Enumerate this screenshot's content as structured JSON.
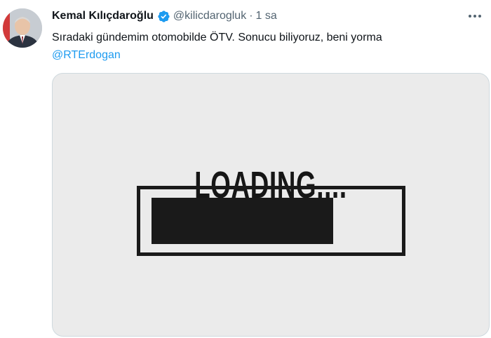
{
  "tweet": {
    "author": {
      "display_name": "Kemal Kılıçdaroğlu",
      "handle": "@kilicdarogluk",
      "verified": true,
      "avatar": "profile-photo"
    },
    "separator": "·",
    "time": "1 sa",
    "text": "Sıradaki gündemim otomobilde ÖTV. Sonucu biliyoruz, beni yorma",
    "mention": "@RTErdogan",
    "more_icon": "more-horizontal-icon",
    "media": {
      "loading_text": "LOADING....",
      "progress_fraction": 0.76
    }
  },
  "colors": {
    "verified": "#1d9bf0",
    "mention": "#1d9bf0",
    "muted": "#536471",
    "media_bg": "#ebebeb"
  }
}
